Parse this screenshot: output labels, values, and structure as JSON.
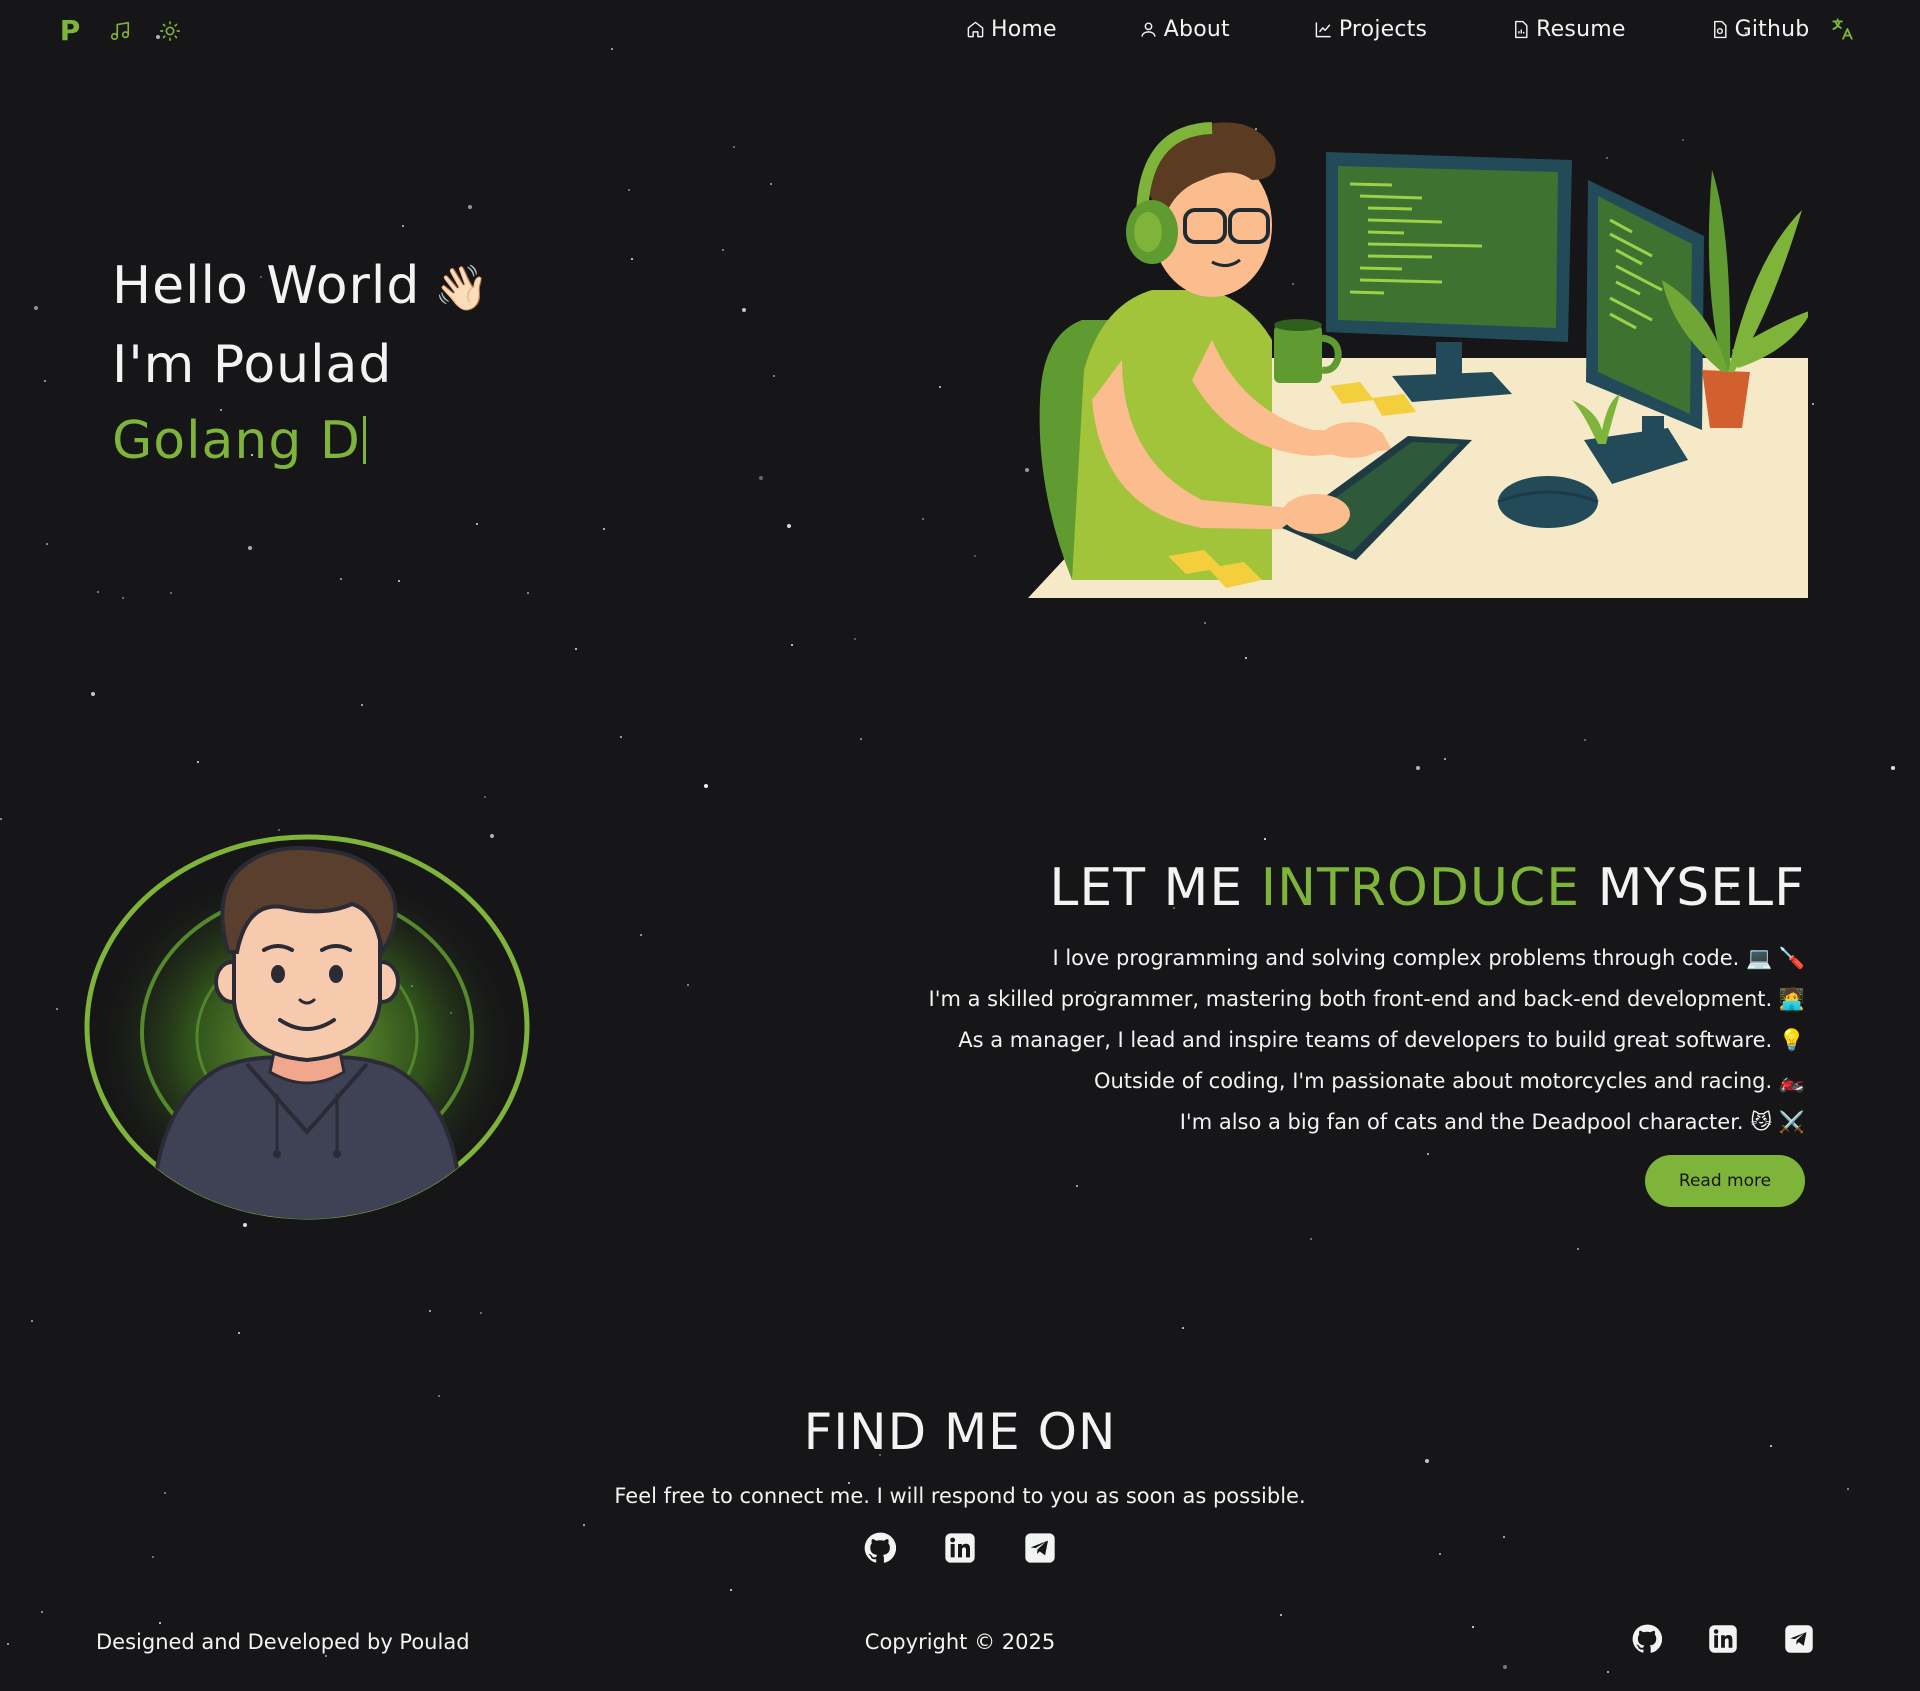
{
  "nav": {
    "logo": "P",
    "music_icon": "music-note-icon",
    "theme_icon": "sun-icon",
    "links": [
      {
        "label": "Home",
        "icon": "home-icon"
      },
      {
        "label": "About",
        "icon": "user-icon"
      },
      {
        "label": "Projects",
        "icon": "chart-icon"
      },
      {
        "label": "Resume",
        "icon": "document-icon"
      },
      {
        "label": "Github",
        "icon": "document-icon"
      }
    ],
    "translate_icon": "translate-icon"
  },
  "hero": {
    "line1": "Hello World",
    "wave": "👋🏻",
    "line2": "I'm Poulad",
    "typed": "Golang D"
  },
  "intro": {
    "title_part1": "LET ME",
    "title_accent": "INTRODUCE",
    "title_part2": "MYSELF",
    "lines": [
      "I love programming and solving complex problems through code. 💻 🪛",
      "I'm a skilled programmer, mastering both front-end and back-end development. 🧑‍💻",
      "As a manager, I lead and inspire teams of developers to build great software. 💡",
      "Outside of coding, I'm passionate about motorcycles and racing. 🏍️",
      "I'm also a big fan of cats and the Deadpool character. 😼 ⚔️"
    ],
    "read_more": "Read more"
  },
  "find": {
    "title": "FIND ME ON",
    "subtitle": "Feel free to connect me. I will respond to you as soon as possible."
  },
  "footer": {
    "left": "Designed and Developed by Poulad",
    "center": "Copyright © 2025"
  },
  "colors": {
    "background": "#161517",
    "accent": "#7fb43a",
    "text": "#f2f4f3"
  }
}
